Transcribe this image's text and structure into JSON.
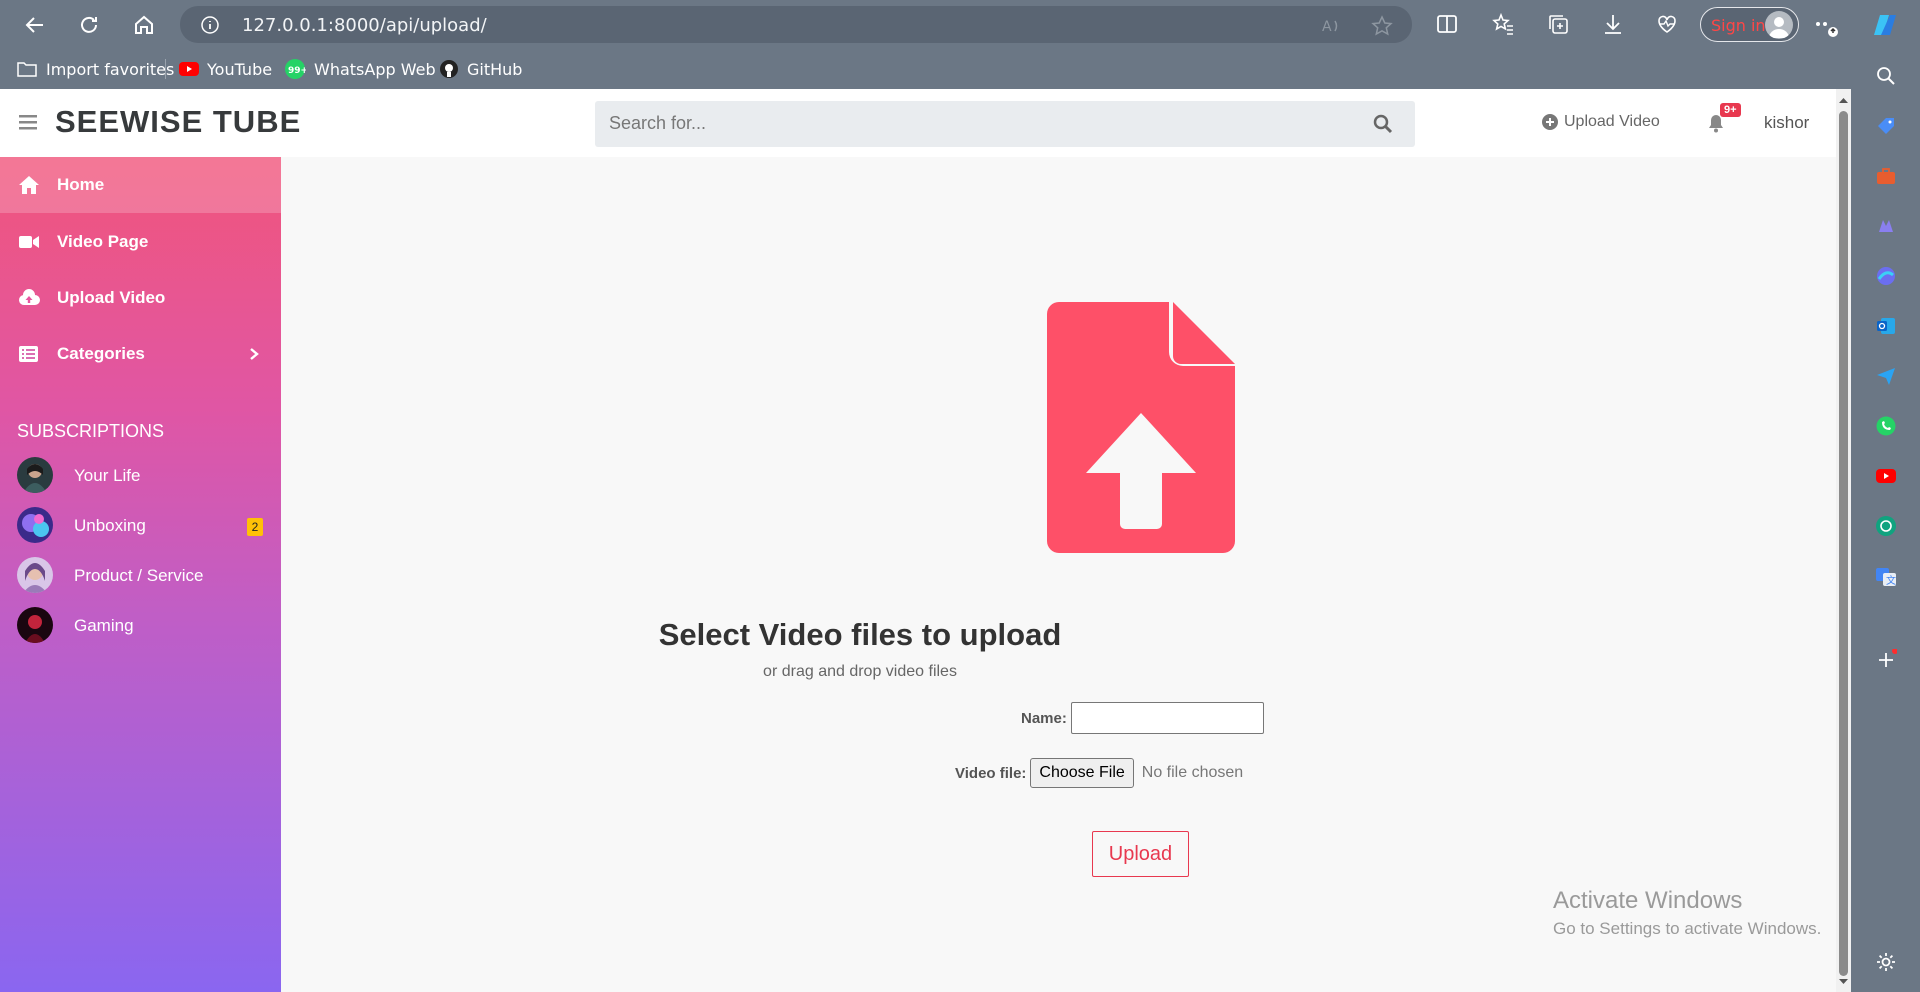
{
  "browser": {
    "url": "127.0.0.1:8000/api/upload/",
    "sign_in": "Sign in",
    "bookmarks": [
      {
        "label": "Import favorites",
        "icon": "folder-import-icon"
      },
      {
        "label": "YouTube",
        "icon": "youtube-icon"
      },
      {
        "label": "WhatsApp Web",
        "icon": "whatsapp-icon",
        "badge": "99+"
      },
      {
        "label": "GitHub",
        "icon": "github-icon"
      }
    ]
  },
  "header": {
    "brand": "SEEWISE TUBE",
    "search_placeholder": "Search for...",
    "upload_link": "Upload Video",
    "notification_count": "9+",
    "username": "kishor"
  },
  "sidebar": {
    "items": [
      {
        "label": "Home",
        "icon": "home-icon"
      },
      {
        "label": "Video Page",
        "icon": "video-camera-icon"
      },
      {
        "label": "Upload Video",
        "icon": "cloud-upload-icon"
      },
      {
        "label": "Categories",
        "icon": "list-icon"
      }
    ],
    "subscriptions_title": "SUBSCRIPTIONS",
    "subscriptions": [
      {
        "label": "Your Life"
      },
      {
        "label": "Unboxing",
        "badge": "2"
      },
      {
        "label": "Product / Service"
      },
      {
        "label": "Gaming"
      }
    ]
  },
  "upload": {
    "title": "Select Video files to upload",
    "subtitle": "or drag and drop video files",
    "name_label": "Name:",
    "file_label": "Video file:",
    "choose_button": "Choose File",
    "no_file": "No file chosen",
    "submit": "Upload"
  },
  "watermark": {
    "line1": "Activate Windows",
    "line2": "Go to Settings to activate Windows."
  },
  "colors": {
    "accent": "#e8384f",
    "upload_icon": "#fe5068",
    "sidebar_top": "#f1557b",
    "sidebar_bottom": "#8a66f0",
    "chrome": "#6b7785"
  }
}
